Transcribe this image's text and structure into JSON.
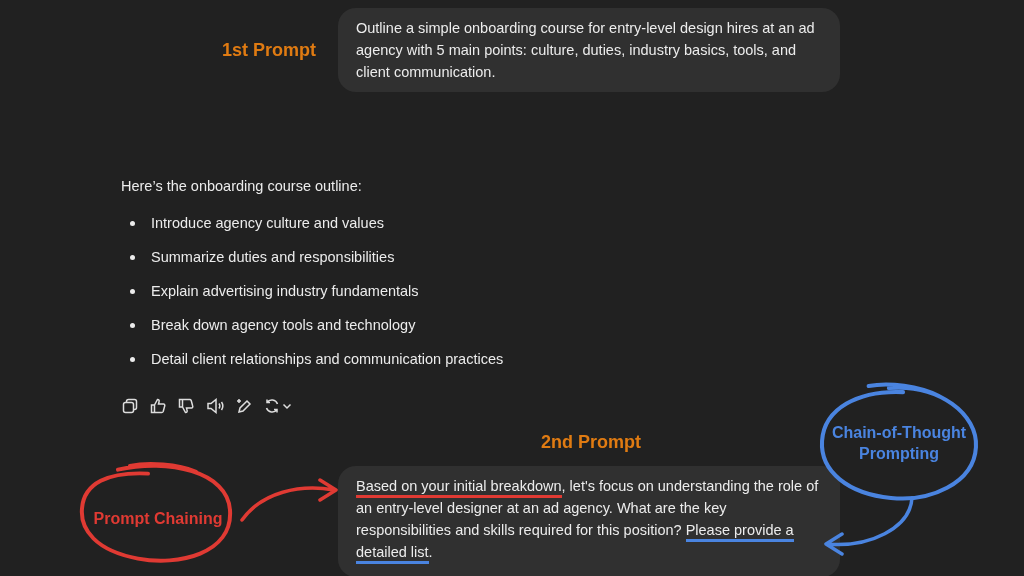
{
  "first_prompt": {
    "label": "1st Prompt",
    "message": "Outline a simple onboarding course for entry-level design hires at an ad agency with 5 main points: culture, duties, industry basics, tools, and client communication."
  },
  "response": {
    "intro": "Here’s the onboarding course outline:",
    "bullets": [
      "Introduce agency culture and values",
      "Summarize duties and responsibilities",
      "Explain advertising industry fundamentals",
      "Break down agency tools and technology",
      "Detail client relationships and communication practices"
    ]
  },
  "second_prompt": {
    "label": "2nd Prompt",
    "segments": [
      {
        "text": "Based on your initial breakdown",
        "color": "#e03a33"
      },
      {
        "text": ", let's focus on understanding the role of an entry-level designer at an ad agency. What are the key responsibilities and skills required for this position? "
      },
      {
        "text": "Please provide a detailed list",
        "color": "#4a84e0"
      },
      {
        "text": "."
      }
    ]
  },
  "annotations": [
    {
      "kind": "chaining",
      "label": "Prompt Chaining",
      "color": "#e03a33"
    },
    {
      "kind": "cot",
      "label": "Chain-of-Thought Prompting",
      "color": "#4a84e0"
    }
  ]
}
